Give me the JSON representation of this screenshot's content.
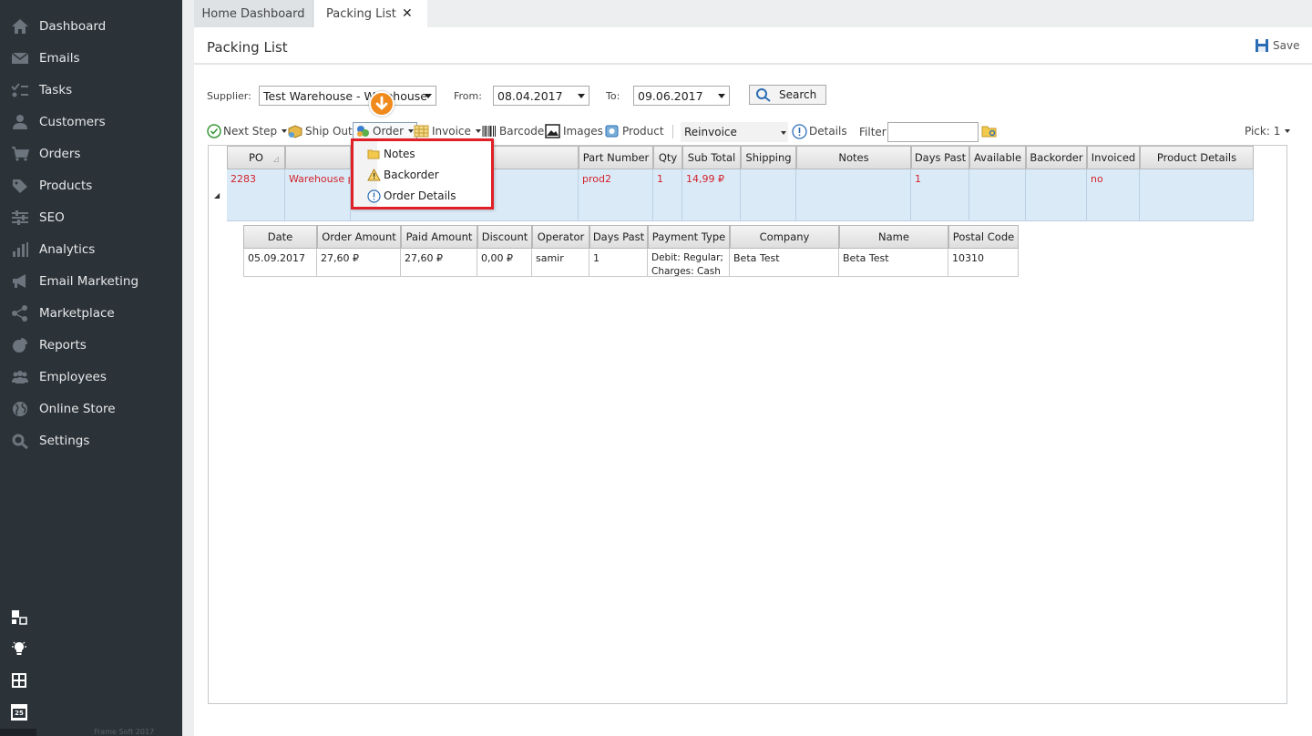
{
  "sidebar": {
    "items": [
      {
        "label": "Dashboard",
        "icon": "home-icon"
      },
      {
        "label": "Emails",
        "icon": "envelope-icon"
      },
      {
        "label": "Tasks",
        "icon": "tasks-icon"
      },
      {
        "label": "Customers",
        "icon": "user-icon"
      },
      {
        "label": "Orders",
        "icon": "cart-icon"
      },
      {
        "label": "Products",
        "icon": "tag-icon"
      },
      {
        "label": "SEO",
        "icon": "sliders-icon"
      },
      {
        "label": "Analytics",
        "icon": "bar-chart-icon"
      },
      {
        "label": "Email Marketing",
        "icon": "megaphone-icon"
      },
      {
        "label": "Marketplace",
        "icon": "share-icon"
      },
      {
        "label": "Reports",
        "icon": "pie-chart-icon"
      },
      {
        "label": "Employees",
        "icon": "users-icon"
      },
      {
        "label": "Online Store",
        "icon": "globe-icon"
      },
      {
        "label": "Settings",
        "icon": "gear-icon"
      }
    ],
    "bottom_icons": [
      "windows-icon",
      "lightbulb-icon",
      "calculator-icon",
      "calendar-icon"
    ],
    "calendar_day": "25",
    "footer": "Frame Soft 2017"
  },
  "tabs": {
    "home": "Home Dashboard",
    "packing": "Packing List",
    "close": "✕"
  },
  "page": {
    "title": "Packing List",
    "save": "Save"
  },
  "filters": {
    "supplier_label": "Supplier:",
    "supplier_value": "Test Warehouse - Warehouse",
    "from_label": "From:",
    "from_value": "08.04.2017",
    "to_label": "To:",
    "to_value": "09.06.2017",
    "search": "Search"
  },
  "toolbar": {
    "next_step": "Next Step",
    "ship_out": "Ship Out",
    "order": "Order",
    "invoice": "Invoice",
    "barcode": "Barcode",
    "images": "Images",
    "product": "Product",
    "reinvoice": "Reinvoice",
    "details": "Details",
    "filter_label": "Filter",
    "filter_value": "",
    "pick": "Pick: 1"
  },
  "order_menu": {
    "items": [
      "Notes",
      "Backorder",
      "Order Details"
    ]
  },
  "grid": {
    "columns": [
      "PO",
      "",
      "",
      "Part Number",
      "Qty",
      "Sub Total",
      "Shipping",
      "Notes",
      "Days Past",
      "Available",
      "Backorder",
      "Invoiced",
      "Product Details"
    ],
    "row": [
      "2283",
      "Warehouse pr",
      "",
      "prod2",
      "1",
      "14,99 ₽",
      "",
      "",
      "1",
      "",
      "",
      "no",
      ""
    ],
    "expand": "◢"
  },
  "subgrid": {
    "columns": [
      "Date",
      "Order Amount",
      "Paid Amount",
      "Discount",
      "Operator",
      "Days Past",
      "Payment Type",
      "Company",
      "Name",
      "Postal Code"
    ],
    "row": [
      "05.09.2017",
      "27,60 ₽",
      "27,60 ₽",
      "0,00 ₽",
      "samir",
      "1",
      "Debit: Regular;\nCharges: Cash",
      "Beta Test",
      "Beta Test",
      "10310"
    ]
  }
}
